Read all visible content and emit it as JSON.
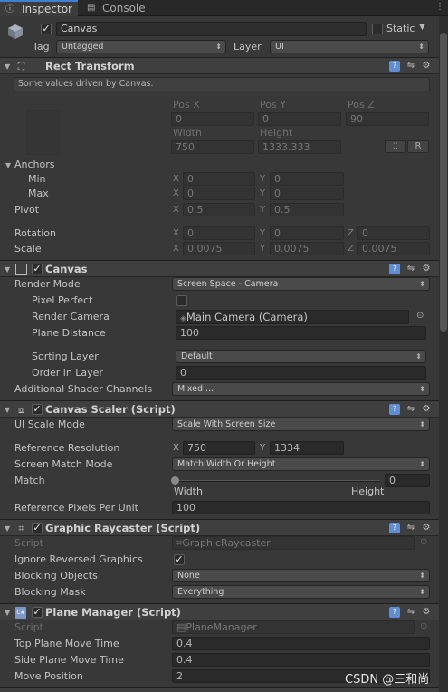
{
  "tabs": {
    "inspector": "Inspector",
    "console": "Console"
  },
  "gameobject": {
    "name": "Canvas",
    "static_label": "Static",
    "tag_label": "Tag",
    "tag_value": "Untagged",
    "layer_label": "Layer",
    "layer_value": "UI",
    "active": true
  },
  "rect_transform": {
    "title": "Rect Transform",
    "hint": "Some values driven by Canvas.",
    "col_labels": [
      "Pos X",
      "Pos Y",
      "Pos Z",
      "Width",
      "Height"
    ],
    "pos_x": "0",
    "pos_y": "0",
    "pos_z": "90",
    "width": "750",
    "height": "1333.333",
    "r_button": "R",
    "anchors_label": "Anchors",
    "min_label": "Min",
    "min_x": "0",
    "min_y": "0",
    "max_label": "Max",
    "max_x": "0",
    "max_y": "0",
    "pivot_label": "Pivot",
    "pivot_x": "0.5",
    "pivot_y": "0.5",
    "rotation_label": "Rotation",
    "rot_x": "0",
    "rot_y": "0",
    "rot_z": "0",
    "scale_label": "Scale",
    "scale_x": "0.0075",
    "scale_y": "0.0075",
    "scale_z": "0.0075",
    "axis": {
      "x": "X",
      "y": "Y",
      "z": "Z"
    }
  },
  "canvas": {
    "title": "Canvas",
    "render_mode_label": "Render Mode",
    "render_mode": "Screen Space - Camera",
    "pixel_perfect_label": "Pixel Perfect",
    "render_camera_label": "Render Camera",
    "render_camera": "Main Camera (Camera)",
    "plane_distance_label": "Plane Distance",
    "plane_distance": "100",
    "sorting_layer_label": "Sorting Layer",
    "sorting_layer": "Default",
    "order_label": "Order in Layer",
    "order": "0",
    "shader_channels_label": "Additional Shader Channels",
    "shader_channels": "Mixed ..."
  },
  "canvas_scaler": {
    "title": "Canvas Scaler (Script)",
    "scale_mode_label": "UI Scale Mode",
    "scale_mode": "Scale With Screen Size",
    "ref_res_label": "Reference Resolution",
    "ref_x": "750",
    "ref_y": "1334",
    "match_mode_label": "Screen Match Mode",
    "match_mode": "Match Width Or Height",
    "match_label": "Match",
    "match_value": "0",
    "match_fraction": 0,
    "width_label": "Width",
    "height_label": "Height",
    "ppu_label": "Reference Pixels Per Unit",
    "ppu": "100"
  },
  "graphic_raycaster": {
    "title": "Graphic Raycaster (Script)",
    "script_label": "Script",
    "script": "GraphicRaycaster",
    "ignore_label": "Ignore Reversed Graphics",
    "blocking_objects_label": "Blocking Objects",
    "blocking_objects": "None",
    "blocking_mask_label": "Blocking Mask",
    "blocking_mask": "Everything"
  },
  "plane_manager": {
    "title": "Plane Manager (Script)",
    "script_label": "Script",
    "script": "PlaneManager",
    "top_label": "Top Plane Move Time",
    "top_value": "0.4",
    "side_label": "Side Plane Move Time",
    "side_value": "0.4",
    "move_label": "Move Position",
    "move_value": "2"
  },
  "watermark": "CSDN @三和尚"
}
